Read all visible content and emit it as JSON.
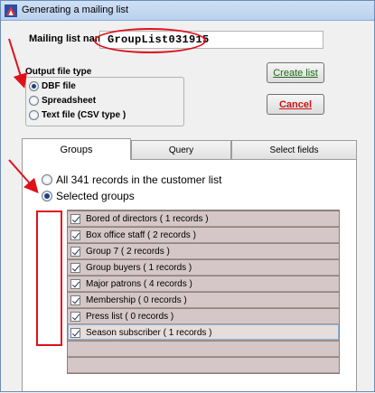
{
  "window": {
    "title": "Generating a mailing list",
    "icon": "app-icon"
  },
  "form": {
    "name_label": "Mailing list name",
    "name_value": "GroupList031915",
    "output_label": "Output file type",
    "output_options": [
      {
        "label": "DBF file",
        "selected": true
      },
      {
        "label": "Spreadsheet",
        "selected": false
      },
      {
        "label": "Text file (CSV type )",
        "selected": false
      }
    ]
  },
  "buttons": {
    "create_label": "Create list",
    "cancel_label": "Cancel"
  },
  "tabs": [
    {
      "label": "Groups",
      "active": true
    },
    {
      "label": "Query",
      "active": false
    },
    {
      "label": "Select fields",
      "active": false
    }
  ],
  "scope": {
    "all_label": "All 341 records in the customer list",
    "selected_label": "Selected groups",
    "selected": "selected_groups"
  },
  "groups": [
    {
      "label": "Bored of directors  ( 1 records )",
      "checked": true
    },
    {
      "label": "Box office staff  ( 2 records )",
      "checked": true
    },
    {
      "label": "Group 7  ( 2 records )",
      "checked": true
    },
    {
      "label": "Group buyers  ( 1 records )",
      "checked": true
    },
    {
      "label": "Major patrons  ( 4 records )",
      "checked": true
    },
    {
      "label": "Membership  ( 0 records )",
      "checked": true
    },
    {
      "label": "Press list  ( 0 records )",
      "checked": true
    },
    {
      "label": "Season subscriber  ( 1 records )",
      "checked": true
    }
  ],
  "colors": {
    "annotation_red": "#e0101a",
    "create_text": "#1c6a1c",
    "cancel_text": "#c81414",
    "list_row": "#d5c7c7"
  }
}
